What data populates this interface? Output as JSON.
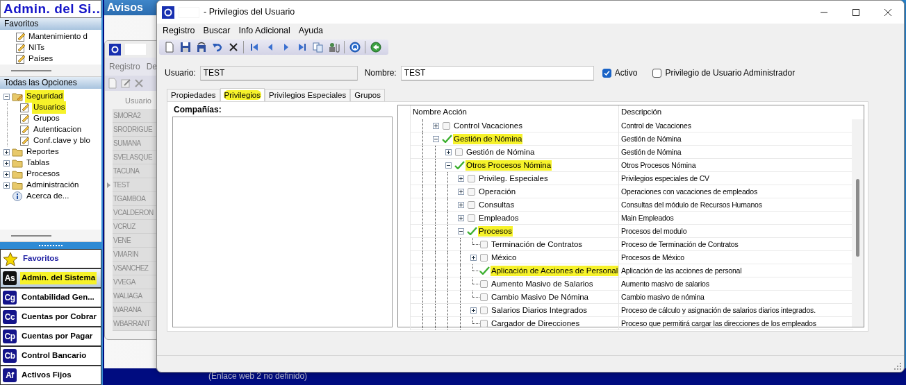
{
  "sidebar": {
    "title": "Admin. del Si…",
    "favorites": {
      "header": "Favoritos",
      "items": [
        "Mantenimiento d",
        "NITs",
        "Países"
      ]
    },
    "all_options": {
      "header": "Todas las Opciones",
      "tree": [
        {
          "label": "Seguridad",
          "kind": "folder",
          "expanded": true,
          "highlighted": true,
          "children": [
            {
              "label": "Usuarios",
              "kind": "page",
              "highlighted": true
            },
            {
              "label": "Grupos",
              "kind": "page",
              "highlighted": false
            },
            {
              "label": "Autenticacion",
              "kind": "page",
              "highlighted": false
            },
            {
              "label": "Conf.clave y blo",
              "kind": "page",
              "highlighted": false
            }
          ]
        },
        {
          "label": "Reportes",
          "kind": "folder",
          "expanded": false,
          "highlighted": false
        },
        {
          "label": "Tablas",
          "kind": "folder",
          "expanded": false,
          "highlighted": false
        },
        {
          "label": "Procesos",
          "kind": "folder",
          "expanded": false,
          "highlighted": false
        },
        {
          "label": "Administración",
          "kind": "folder",
          "expanded": false,
          "highlighted": false
        },
        {
          "label": "Acerca de...",
          "kind": "info",
          "highlighted": false
        }
      ]
    },
    "modules": [
      {
        "kind": "star",
        "label": "Favoritos",
        "selected": false,
        "highlighted": false
      },
      {
        "kind": "app",
        "abbr": "As",
        "label": "Admin. del Sistema",
        "selected": true,
        "highlighted": true
      },
      {
        "kind": "app",
        "abbr": "Cg",
        "label": "Contabilidad  Gen...",
        "selected": false,
        "highlighted": false
      },
      {
        "kind": "app",
        "abbr": "Cc",
        "label": "Cuentas por Cobrar",
        "selected": false,
        "highlighted": false
      },
      {
        "kind": "app",
        "abbr": "Cp",
        "label": "Cuentas por Pagar",
        "selected": false,
        "highlighted": false
      },
      {
        "kind": "app",
        "abbr": "Cb",
        "label": "Control Bancario",
        "selected": false,
        "highlighted": false
      },
      {
        "kind": "app",
        "abbr": "Af",
        "label": "Activos Fijos",
        "selected": false,
        "highlighted": false
      }
    ]
  },
  "notices": {
    "title": "Avisos",
    "link": "(Enlace web 2 no definido)"
  },
  "users_window": {
    "menu": [
      "Registro",
      "De"
    ],
    "column": "Usuario",
    "rows": [
      {
        "user": "SMORA2",
        "selected": false
      },
      {
        "user": "SRODRIGUE",
        "selected": false
      },
      {
        "user": "SUMANA",
        "selected": false
      },
      {
        "user": "SVELASQUE",
        "selected": false
      },
      {
        "user": "TACUNA",
        "selected": false
      },
      {
        "user": "TEST",
        "selected": true
      },
      {
        "user": "TGAMBOA",
        "selected": false
      },
      {
        "user": "VCALDERON",
        "selected": false
      },
      {
        "user": "VCRUZ",
        "selected": false
      },
      {
        "user": "VENE",
        "selected": false
      },
      {
        "user": "VMARIN",
        "selected": false
      },
      {
        "user": "VSANCHEZ",
        "selected": false
      },
      {
        "user": "VVEGA",
        "selected": false
      },
      {
        "user": "WALIAGA",
        "selected": false
      },
      {
        "user": "WARANA",
        "selected": false
      },
      {
        "user": "WBARRANT",
        "selected": false
      }
    ]
  },
  "main_window": {
    "title": "- Privilegios del Usuario",
    "menu": [
      "Registro",
      "Buscar",
      "Info Adicional",
      "Ayuda"
    ],
    "user_field": {
      "label": "Usuario:",
      "value": "TEST"
    },
    "name_field": {
      "label": "Nombre:",
      "value": "TEST"
    },
    "checkboxes": [
      {
        "label": "Activo",
        "checked": true
      },
      {
        "label": "Privilegio de Usuario Administrador",
        "checked": false
      }
    ],
    "tabs": [
      {
        "label": "Propiedades",
        "selected": false,
        "highlighted": false
      },
      {
        "label": "Privilegios",
        "selected": true,
        "highlighted": true
      },
      {
        "label": "Privilegios Especiales",
        "selected": false,
        "highlighted": false
      },
      {
        "label": "Grupos",
        "selected": false,
        "highlighted": false
      }
    ],
    "companies": {
      "label": "Compañías:"
    },
    "privileges": {
      "columns": [
        "Nombre Acción",
        "Descripción"
      ],
      "tree": [
        {
          "name": "Control Vacaciones",
          "description": "Control de Vacaciones",
          "kind": "group",
          "expanded": false,
          "checked": false,
          "highlighted": false
        },
        {
          "name": "Gestión de Nómina",
          "description": "Gestión de Nómina",
          "kind": "group",
          "expanded": true,
          "checked": true,
          "highlighted": true,
          "children": [
            {
              "name": "Gestión de Nómina",
              "description": "Gestión de Nómina",
              "kind": "group",
              "expanded": false,
              "checked": false,
              "highlighted": false
            },
            {
              "name": "Otros Procesos Nómina",
              "description": "Otros Procesos Nómina",
              "kind": "group",
              "expanded": true,
              "checked": true,
              "highlighted": true,
              "children": [
                {
                  "name": "Privileg. Especiales",
                  "description": "Privilegios especiales de CV",
                  "kind": "group",
                  "expanded": false,
                  "checked": false,
                  "highlighted": false
                },
                {
                  "name": "Operación",
                  "description": "Operaciones con vacaciones de empleados",
                  "kind": "group",
                  "expanded": false,
                  "checked": false,
                  "highlighted": false
                },
                {
                  "name": "Consultas",
                  "description": "Consultas del módulo de Recursos Humanos",
                  "kind": "group",
                  "expanded": false,
                  "checked": false,
                  "highlighted": false
                },
                {
                  "name": "Empleados",
                  "description": "Main Empleados",
                  "kind": "group",
                  "expanded": false,
                  "checked": false,
                  "highlighted": false
                },
                {
                  "name": "Procesos",
                  "description": "Procesos del modulo",
                  "kind": "group",
                  "expanded": true,
                  "checked": true,
                  "highlighted": true,
                  "children": [
                    {
                      "name": "Terminación de Contratos",
                      "description": "Proceso de Terminación de Contratos",
                      "kind": "leaf",
                      "checked": false,
                      "highlighted": false
                    },
                    {
                      "name": "México",
                      "description": "Procesos de México",
                      "kind": "group",
                      "expanded": false,
                      "checked": false,
                      "highlighted": false
                    },
                    {
                      "name": "Aplicación de Acciones de Personal",
                      "description": "Aplicación de las acciones de personal",
                      "kind": "leaf",
                      "checked": true,
                      "highlighted": true
                    },
                    {
                      "name": "Aumento Masivo de Salarios",
                      "description": "Aumento masivo de salarios",
                      "kind": "leaf",
                      "checked": false,
                      "highlighted": false
                    },
                    {
                      "name": "Cambio Masivo De Nómina",
                      "description": "Cambio masivo de nómina",
                      "kind": "leaf",
                      "checked": false,
                      "highlighted": false
                    },
                    {
                      "name": "Salarios Diarios Integrados",
                      "description": "Proceso de cálculo y asignación de salarios diarios integrados.",
                      "kind": "group",
                      "expanded": false,
                      "checked": false,
                      "highlighted": false
                    },
                    {
                      "name": "Cargador de Direcciones",
                      "description": "Proceso que permitirá cargar las direcciones de los empleados",
                      "kind": "leaf",
                      "checked": false,
                      "highlighted": false
                    }
                  ]
                }
              ]
            }
          ]
        }
      ]
    }
  }
}
